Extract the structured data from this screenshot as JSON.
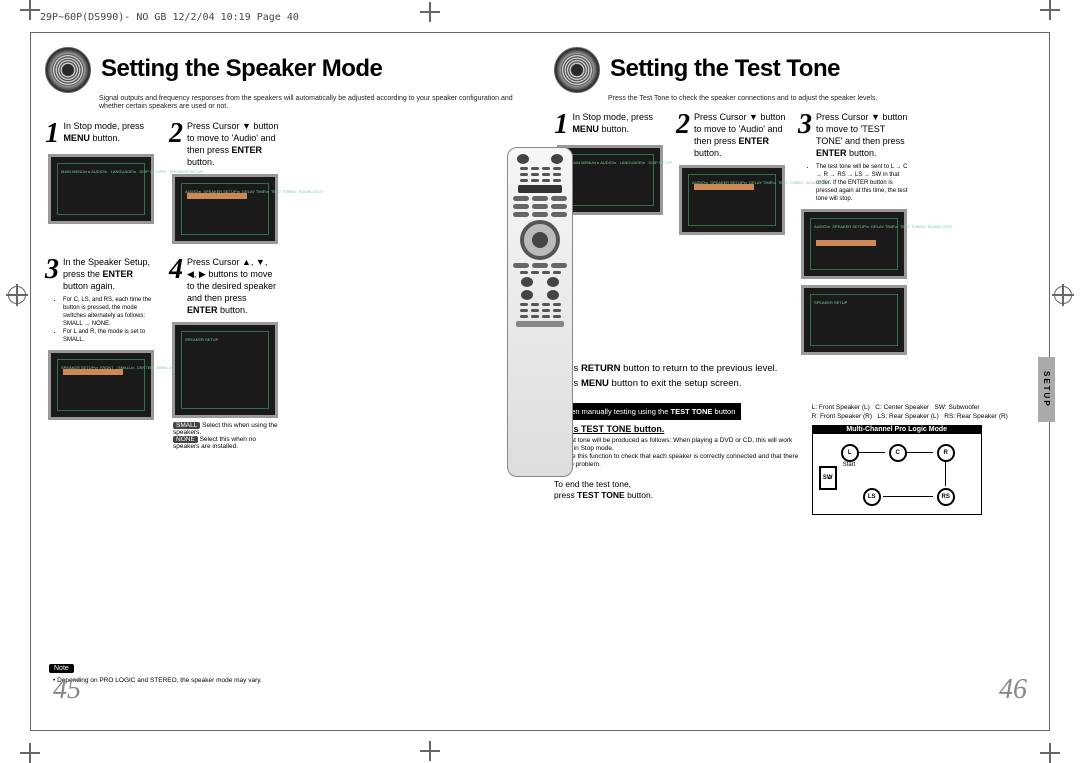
{
  "header": "29P~60P(DS990)- NO GB  12/2/04 10:19  Page 40",
  "left": {
    "title": "Setting the Speaker Mode",
    "subtitle": "Signal outputs and frequency responses from the speakers will automatically be adjusted according to your speaker configuration and whether certain speakers are used or not.",
    "step1": {
      "num": "1",
      "text": "In Stop mode, press MENU button."
    },
    "step2": {
      "num": "2",
      "text": "Press Cursor ▼ button to move to 'Audio' and then press ENTER button."
    },
    "step3": {
      "num": "3",
      "text": "In the Speaker Setup, press the ENTER button again."
    },
    "step4": {
      "num": "4",
      "text": "Press Cursor ▲, ▼, ◀, ▶ buttons to move to the desired speaker and then press ENTER button."
    },
    "smallnote_small": "Select this when using the speakers.",
    "smallnote_none": "Select this when no speakers are installed.",
    "bullets": [
      "For C, LS, and RS, each time the button is pressed, the mode switches alternately as follows: SMALL → NONE.",
      "For L and R, the mode is set to SMALL."
    ],
    "note_title": "Note",
    "foot_note": "Depending on PRO LOGIC and STEREO, the speaker mode may vary.",
    "page": "45"
  },
  "right": {
    "title": "Setting the Test Tone",
    "subtitle": "Press the Test Tone to check the speaker connections and to adjust the speaker levels.",
    "step1": {
      "num": "1",
      "text": "In Stop mode, press MENU button."
    },
    "step2": {
      "num": "2",
      "text": "Press Cursor ▼ button to move to 'Audio' and then press ENTER button."
    },
    "step3": {
      "num": "3",
      "text": "Press Cursor ▼ button to move to 'TEST TONE' and then press ENTER button."
    },
    "step3_bullet": "The test tone will be sent to L → C → R → RS → LS → SW in that order. If the ENTER button is pressed again at this time, the test tone will stop.",
    "return_note": "Press RETURN button to return to the previous level.",
    "exit_note": "Press MENU button to exit the setup screen.",
    "manual_bar": "When manually testing using the TEST TONE button",
    "tt_heading": "Press TEST TONE button.",
    "tt_bullets": [
      "Test tone will be produced as follows: When playing a DVD or CD, this will work only in Stop mode.",
      "Use this function to check that each speaker is correctly connected and that there is no problem."
    ],
    "tt_end": "To end the test tone, press TEST TONE button.",
    "legend": {
      "L": "L: Front Speaker (L)",
      "R": "R: Front Speaker (R)",
      "C": "C: Center Speaker",
      "LS": "LS: Rear Speaker (L)",
      "SW": "SW: Subwoofer",
      "RS": "RS: Rear Speaker (R)"
    },
    "diagram_title": "Multi-Channel Pro Logic Mode",
    "diagram_start": "Start",
    "setup_tab": "SETUP",
    "page": "46"
  },
  "smallbox": {
    "small": "SMALL",
    "none": "NONE"
  }
}
